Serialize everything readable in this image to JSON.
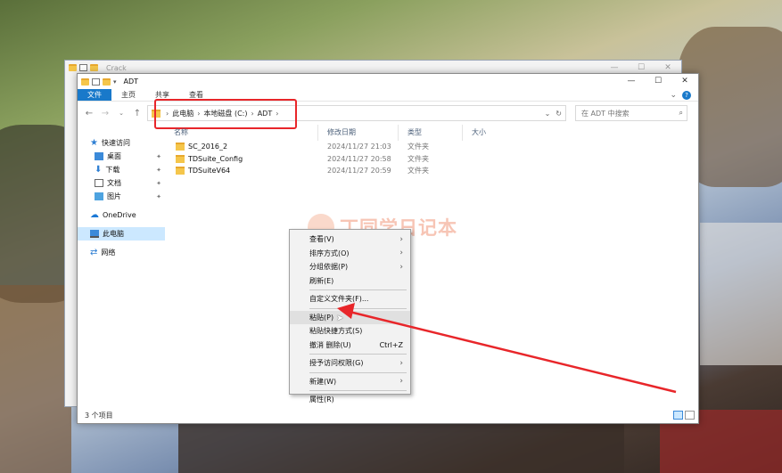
{
  "background_window": {
    "title": "Crack",
    "controls": [
      "—",
      "☐",
      "✕"
    ]
  },
  "window": {
    "title": "ADT",
    "controls": [
      "—",
      "☐",
      "✕"
    ],
    "ribbon_tabs": [
      "文件",
      "主页",
      "共享",
      "查看"
    ],
    "address": {
      "crumbs": [
        "此电脑",
        "本地磁盘 (C:)",
        "ADT"
      ]
    },
    "search_placeholder": "在 ADT 中搜索",
    "columns": [
      "名称",
      "修改日期",
      "类型",
      "大小"
    ],
    "files": [
      {
        "name": "SC_2016_2",
        "date": "2024/11/27 21:03",
        "type": "文件夹"
      },
      {
        "name": "TDSuite_Config",
        "date": "2024/11/27 20:58",
        "type": "文件夹"
      },
      {
        "name": "TDSuiteV64",
        "date": "2024/11/27 20:59",
        "type": "文件夹"
      }
    ],
    "sidebar": {
      "quick_access": "快速访问",
      "items": [
        "桌面",
        "下载",
        "文档",
        "图片"
      ],
      "onedrive": "OneDrive",
      "this_pc": "此电脑",
      "network": "网络"
    },
    "status": "3 个项目"
  },
  "watermark": "丁同学日记本",
  "context_menu": {
    "view": "查看(V)",
    "sort": "排序方式(O)",
    "group": "分组依据(P)",
    "refresh": "刷新(E)",
    "customize": "自定义文件夹(F)...",
    "paste": "粘贴(P)",
    "paste_shortcut": "粘贴快捷方式(S)",
    "undo": "撤消 删除(U)",
    "undo_key": "Ctrl+Z",
    "access": "授予访问权限(G)",
    "new": "新建(W)",
    "properties": "属性(R)"
  },
  "colors": {
    "accent": "#1979ca",
    "annotation": "#e8262a",
    "selection": "#cce8ff"
  }
}
